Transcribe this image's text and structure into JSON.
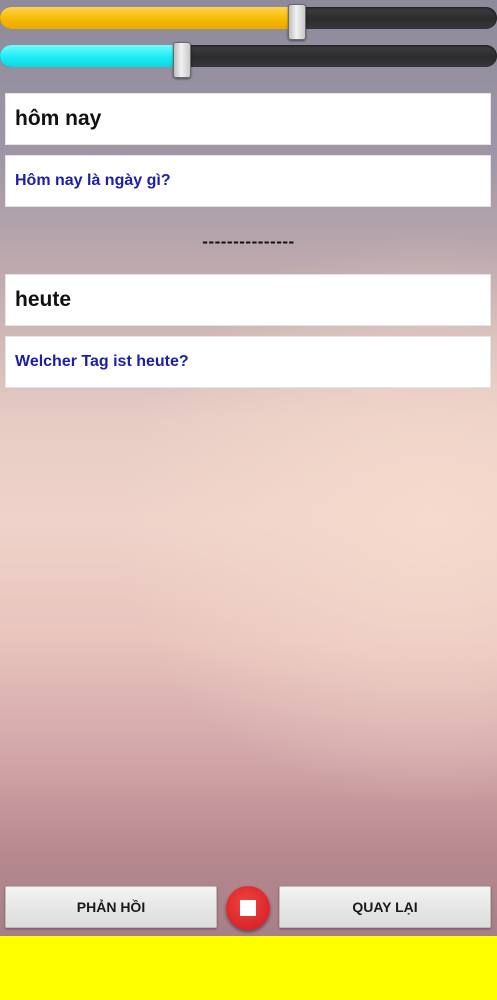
{
  "sliders": {
    "speed": {
      "value": 0.595,
      "color": "#f5b800"
    },
    "pitch": {
      "value": 0.365,
      "color": "#18eaf4"
    }
  },
  "source": {
    "word": "hôm nay",
    "sentence": "Hôm nay là ngày gì?"
  },
  "divider": "---------------",
  "target": {
    "word": "heute",
    "sentence": "Welcher Tag ist heute?"
  },
  "buttons": {
    "feedback_label": "PHẢN HỒI",
    "back_label": "QUAY LẠI",
    "stop_icon": "stop-icon",
    "stop_color": "#d9262a"
  },
  "ad_banner": {
    "color": "#ffff00"
  }
}
